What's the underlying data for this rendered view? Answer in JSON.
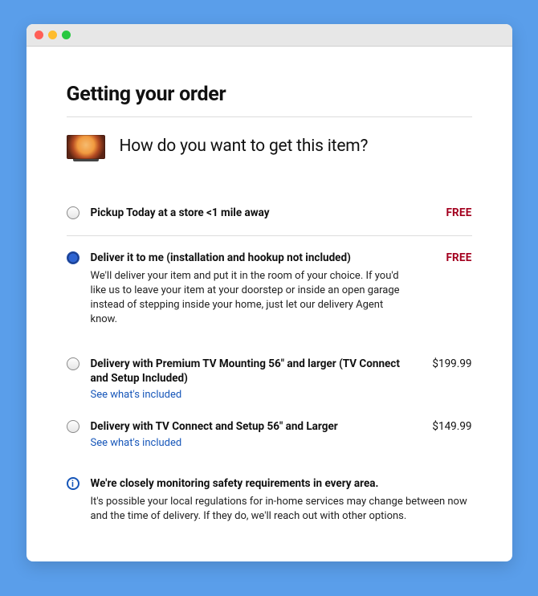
{
  "page": {
    "title": "Getting your order",
    "prompt": "How do you want to get this item?"
  },
  "options": {
    "pickup": {
      "label": "Pickup Today at a store <1 mile away",
      "price": "FREE"
    },
    "deliver": {
      "label": "Deliver it to me (installation and hookup not included)",
      "price": "FREE",
      "desc": "We'll deliver your item and put it in the room of your choice. If you'd like us to leave your item at your doorstep or inside an open garage instead of stepping inside your home, just let our delivery Agent know."
    },
    "mounting": {
      "label": "Delivery with Premium TV Mounting 56\" and larger (TV Connect and Setup Included)",
      "price": "$199.99",
      "link": "See what's included"
    },
    "connect": {
      "label": "Delivery with TV Connect and Setup 56\" and Larger",
      "price": "$149.99",
      "link": "See what's included"
    }
  },
  "notice": {
    "title": "We're closely monitoring safety requirements in every area.",
    "text": "It's possible your local regulations for in-home services may change between now and the time of delivery. If they do, we'll reach out with other options."
  }
}
